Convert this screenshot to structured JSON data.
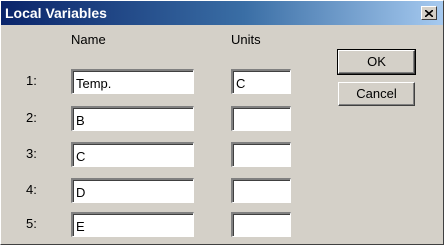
{
  "window": {
    "title": "Local Variables"
  },
  "headers": {
    "name": "Name",
    "units": "Units"
  },
  "rows": [
    {
      "index": "1:",
      "name": "Temp.",
      "unit": "C"
    },
    {
      "index": "2:",
      "name": "B",
      "unit": ""
    },
    {
      "index": "3:",
      "name": "C",
      "unit": ""
    },
    {
      "index": "4:",
      "name": "D",
      "unit": ""
    },
    {
      "index": "5:",
      "name": "E",
      "unit": ""
    }
  ],
  "buttons": {
    "ok": "OK",
    "cancel": "Cancel"
  },
  "colors": {
    "titlebar_start": "#0a246a",
    "titlebar_end": "#a6caf0",
    "face": "#d4d0c8"
  },
  "icons": {
    "close": "close-icon"
  }
}
